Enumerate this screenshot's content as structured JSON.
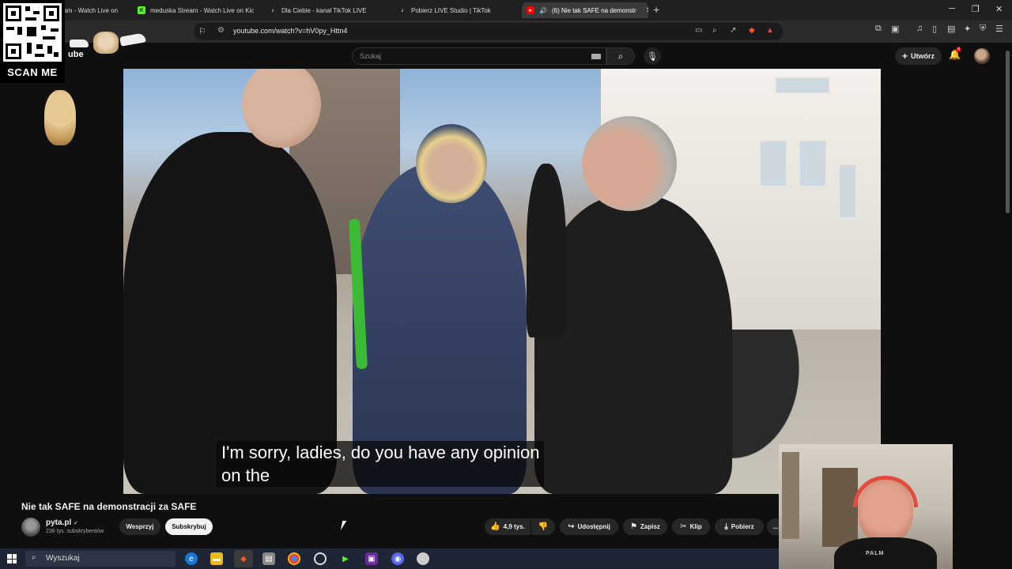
{
  "browser": {
    "tabs": [
      {
        "label": "eam - Watch Live on",
        "icon": "live-stream-icon"
      },
      {
        "label": "meduska Stream - Watch Live on Kic",
        "icon": "kick-icon"
      },
      {
        "label": "Dla Ciebie - kanał TikTok LIVE",
        "icon": "tiktok-icon"
      },
      {
        "label": "Pobierz LIVE Studio | TikTok",
        "icon": "tiktok-icon"
      },
      {
        "label": "(6) Nie tak SAFE na demonstr",
        "icon": "youtube-icon",
        "active": true
      }
    ],
    "url": "youtube.com/watch?v=hV0py_Httn4"
  },
  "overlay": {
    "scan_label": "SCAN ME",
    "yt_fragment": "ube"
  },
  "masthead": {
    "search_placeholder": "Szukaj",
    "create_label": "Utwórz",
    "notification_count": "6"
  },
  "video": {
    "caption_line1": "I'm sorry, ladies, do you have any opinion",
    "caption_line2": "on the"
  },
  "info": {
    "title": "Nie tak SAFE na demonstracji za SAFE",
    "channel_name": "pyta.pl",
    "subscribers": "236 tys. subskrybentów",
    "support_label": "Wesprzyj",
    "subscribe_label": "Subskrybuj",
    "likes": "4,9 tys.",
    "share_label": "Udostępnij",
    "save_label": "Zapisz",
    "clip_label": "Klip",
    "download_label": "Pobierz",
    "more_label": "..."
  },
  "cam": {
    "shirt_text": "PALM"
  },
  "taskbar": {
    "search_label": "Wyszukaj"
  },
  "colors": {
    "accent_red": "#cc0000",
    "background": "#0f0f0f"
  }
}
